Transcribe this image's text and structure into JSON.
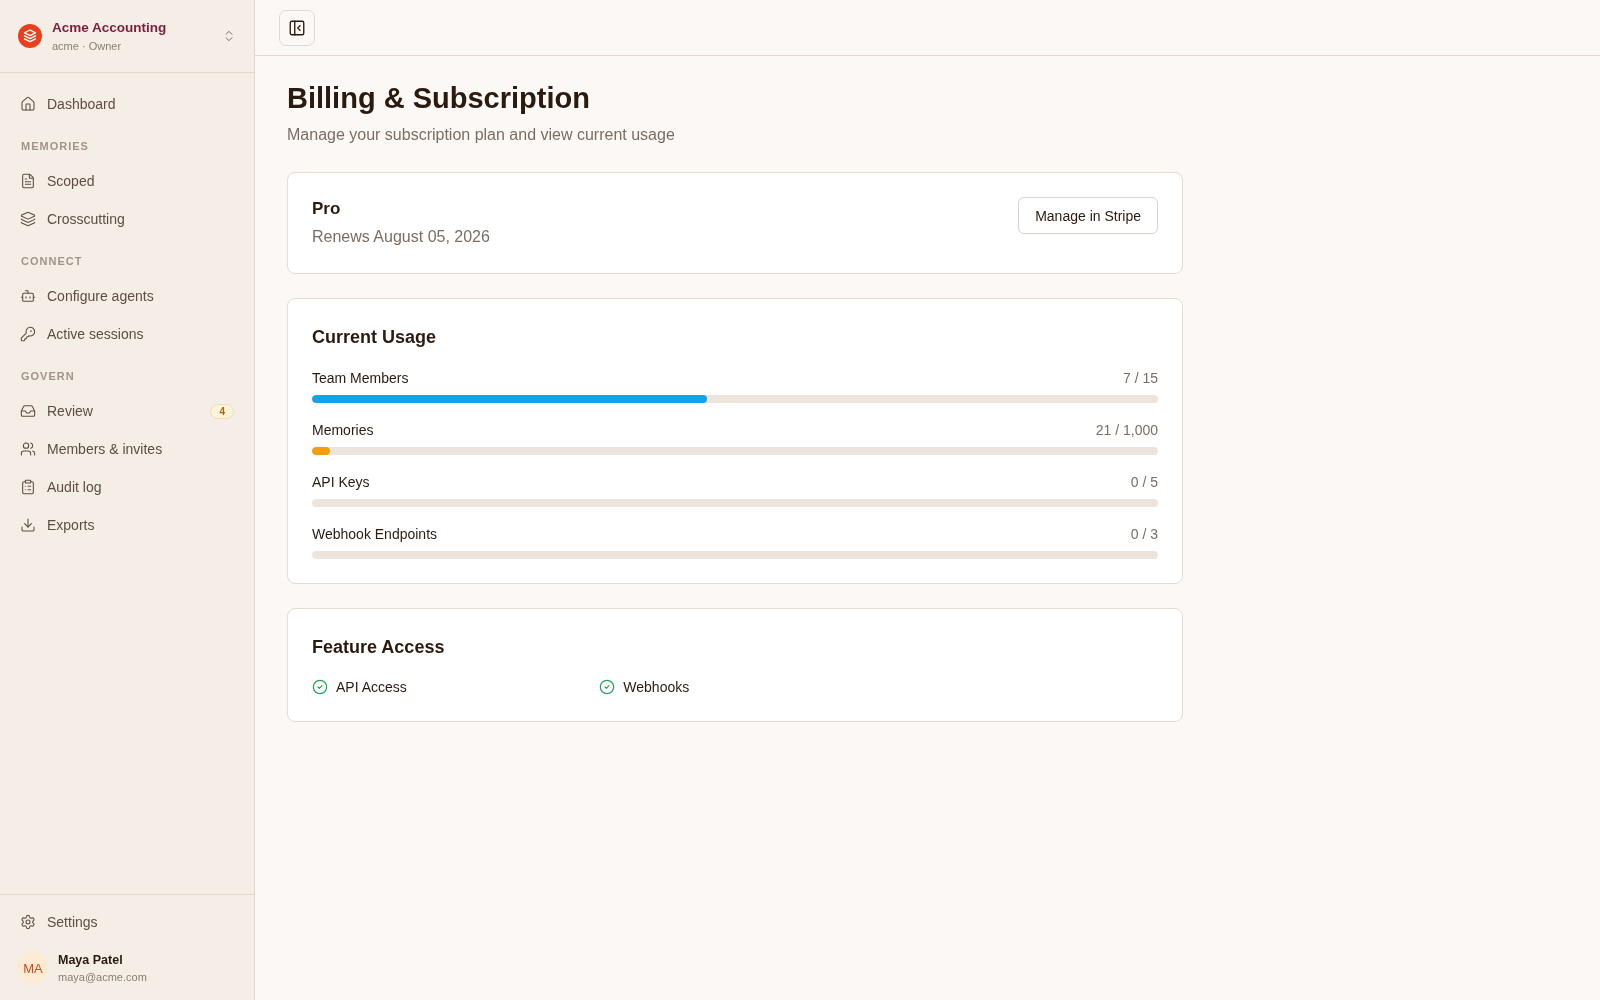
{
  "sidebar": {
    "org": {
      "name": "Acme Accounting",
      "subtitle": "acme · Owner"
    },
    "groups": [
      {
        "items": [
          {
            "label": "Dashboard",
            "selected": false
          }
        ]
      },
      {
        "title": "MEMORIES",
        "items": [
          {
            "label": "Scoped",
            "selected": false
          },
          {
            "label": "Crosscutting",
            "selected": false
          }
        ]
      },
      {
        "title": "CONNECT",
        "items": [
          {
            "label": "Configure agents",
            "selected": false
          },
          {
            "label": "Active sessions",
            "selected": false
          }
        ]
      },
      {
        "title": "GOVERN",
        "items": [
          {
            "label": "Review",
            "selected": false,
            "badge": "4"
          },
          {
            "label": "Members & invites",
            "selected": false
          },
          {
            "label": "Audit log",
            "selected": false
          },
          {
            "label": "Exports",
            "selected": false
          }
        ]
      }
    ],
    "footer_items": [
      {
        "label": "Settings",
        "selected": false
      }
    ],
    "user": {
      "initials": "MA",
      "name": "Maya Patel",
      "email": "maya@acme.com"
    }
  },
  "page": {
    "title": "Billing & Subscription",
    "subtitle": "Manage your subscription plan and view current usage"
  },
  "plan": {
    "name": "Pro",
    "renewal": "Renews August 05, 2026",
    "button": "Manage in Stripe"
  },
  "usage": {
    "title": "Current Usage",
    "rows": [
      {
        "label": "Team Members",
        "reading": "7 / 15",
        "level": 0.467,
        "color": "#0ea5e9"
      },
      {
        "label": "Memories",
        "reading": "21 / 1,000",
        "level": 0.021,
        "color": "#f59e0b"
      },
      {
        "label": "API Keys",
        "reading": "0 / 5"
      },
      {
        "label": "Webhook Endpoints",
        "reading": "0 / 3"
      }
    ]
  },
  "features": {
    "title": "Feature Access",
    "items": [
      {
        "label": "API Access",
        "enabled": true
      },
      {
        "label": "Webhooks",
        "enabled": true
      }
    ]
  }
}
